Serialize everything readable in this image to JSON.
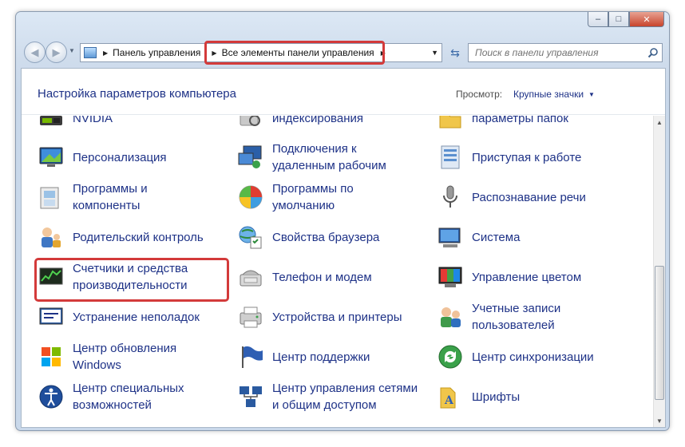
{
  "window": {
    "caption_buttons": {
      "minimize": "–",
      "maximize": "□",
      "close": "✕"
    }
  },
  "navbar": {
    "back_glyph": "◀",
    "forward_glyph": "▶",
    "breadcrumbs": [
      "Панель управления",
      "Все элементы панели управления"
    ],
    "crumb_separator": "▶",
    "address_dropdown": "▼",
    "refresh_glyph": "⇆",
    "search_placeholder": "Поиск в панели управления"
  },
  "header": {
    "title": "Настройка параметров компьютера",
    "view_label": "Просмотр:",
    "view_value": "Крупные значки",
    "view_dropdown": "▼"
  },
  "items": [
    {
      "label": "NVIDIA",
      "icon": "nvidia-icon"
    },
    {
      "label": "индексирования",
      "icon": "indexing-options-icon"
    },
    {
      "label": "параметры папок",
      "icon": "folder-options-icon"
    },
    {
      "label": "Персонализация",
      "icon": "personalization-icon"
    },
    {
      "label": "Подключения к\nудаленным рабочим",
      "icon": "remote-desktop-icon"
    },
    {
      "label": "Приступая к работе",
      "icon": "getting-started-icon"
    },
    {
      "label": "Программы и\nкомпоненты",
      "icon": "programs-features-icon"
    },
    {
      "label": "Программы по\nумолчанию",
      "icon": "default-programs-icon"
    },
    {
      "label": "Распознавание речи",
      "icon": "microphone-icon"
    },
    {
      "label": "Родительский контроль",
      "icon": "parental-controls-icon"
    },
    {
      "label": "Свойства браузера",
      "icon": "internet-options-icon"
    },
    {
      "label": "Система",
      "icon": "system-icon"
    },
    {
      "label": "Счетчики и средства\nпроизводительности",
      "icon": "performance-icon"
    },
    {
      "label": "Телефон и модем",
      "icon": "phone-modem-icon"
    },
    {
      "label": "Управление цветом",
      "icon": "color-management-icon"
    },
    {
      "label": "Устранение неполадок",
      "icon": "troubleshooting-icon"
    },
    {
      "label": "Устройства и принтеры",
      "icon": "devices-printers-icon"
    },
    {
      "label": "Учетные записи\nпользователей",
      "icon": "user-accounts-icon"
    },
    {
      "label": "Центр обновления\nWindows",
      "icon": "windows-update-icon"
    },
    {
      "label": "Центр поддержки",
      "icon": "action-center-flag-icon"
    },
    {
      "label": "Центр синхронизации",
      "icon": "sync-center-icon"
    },
    {
      "label": "Центр специальных\nвозможностей",
      "icon": "ease-of-access-icon"
    },
    {
      "label": "Центр управления сетями\nи общим доступом",
      "icon": "network-center-icon"
    },
    {
      "label": "Шрифты",
      "icon": "fonts-icon"
    }
  ],
  "colors": {
    "link": "#1e3287",
    "highlight": "#d33a3a"
  }
}
